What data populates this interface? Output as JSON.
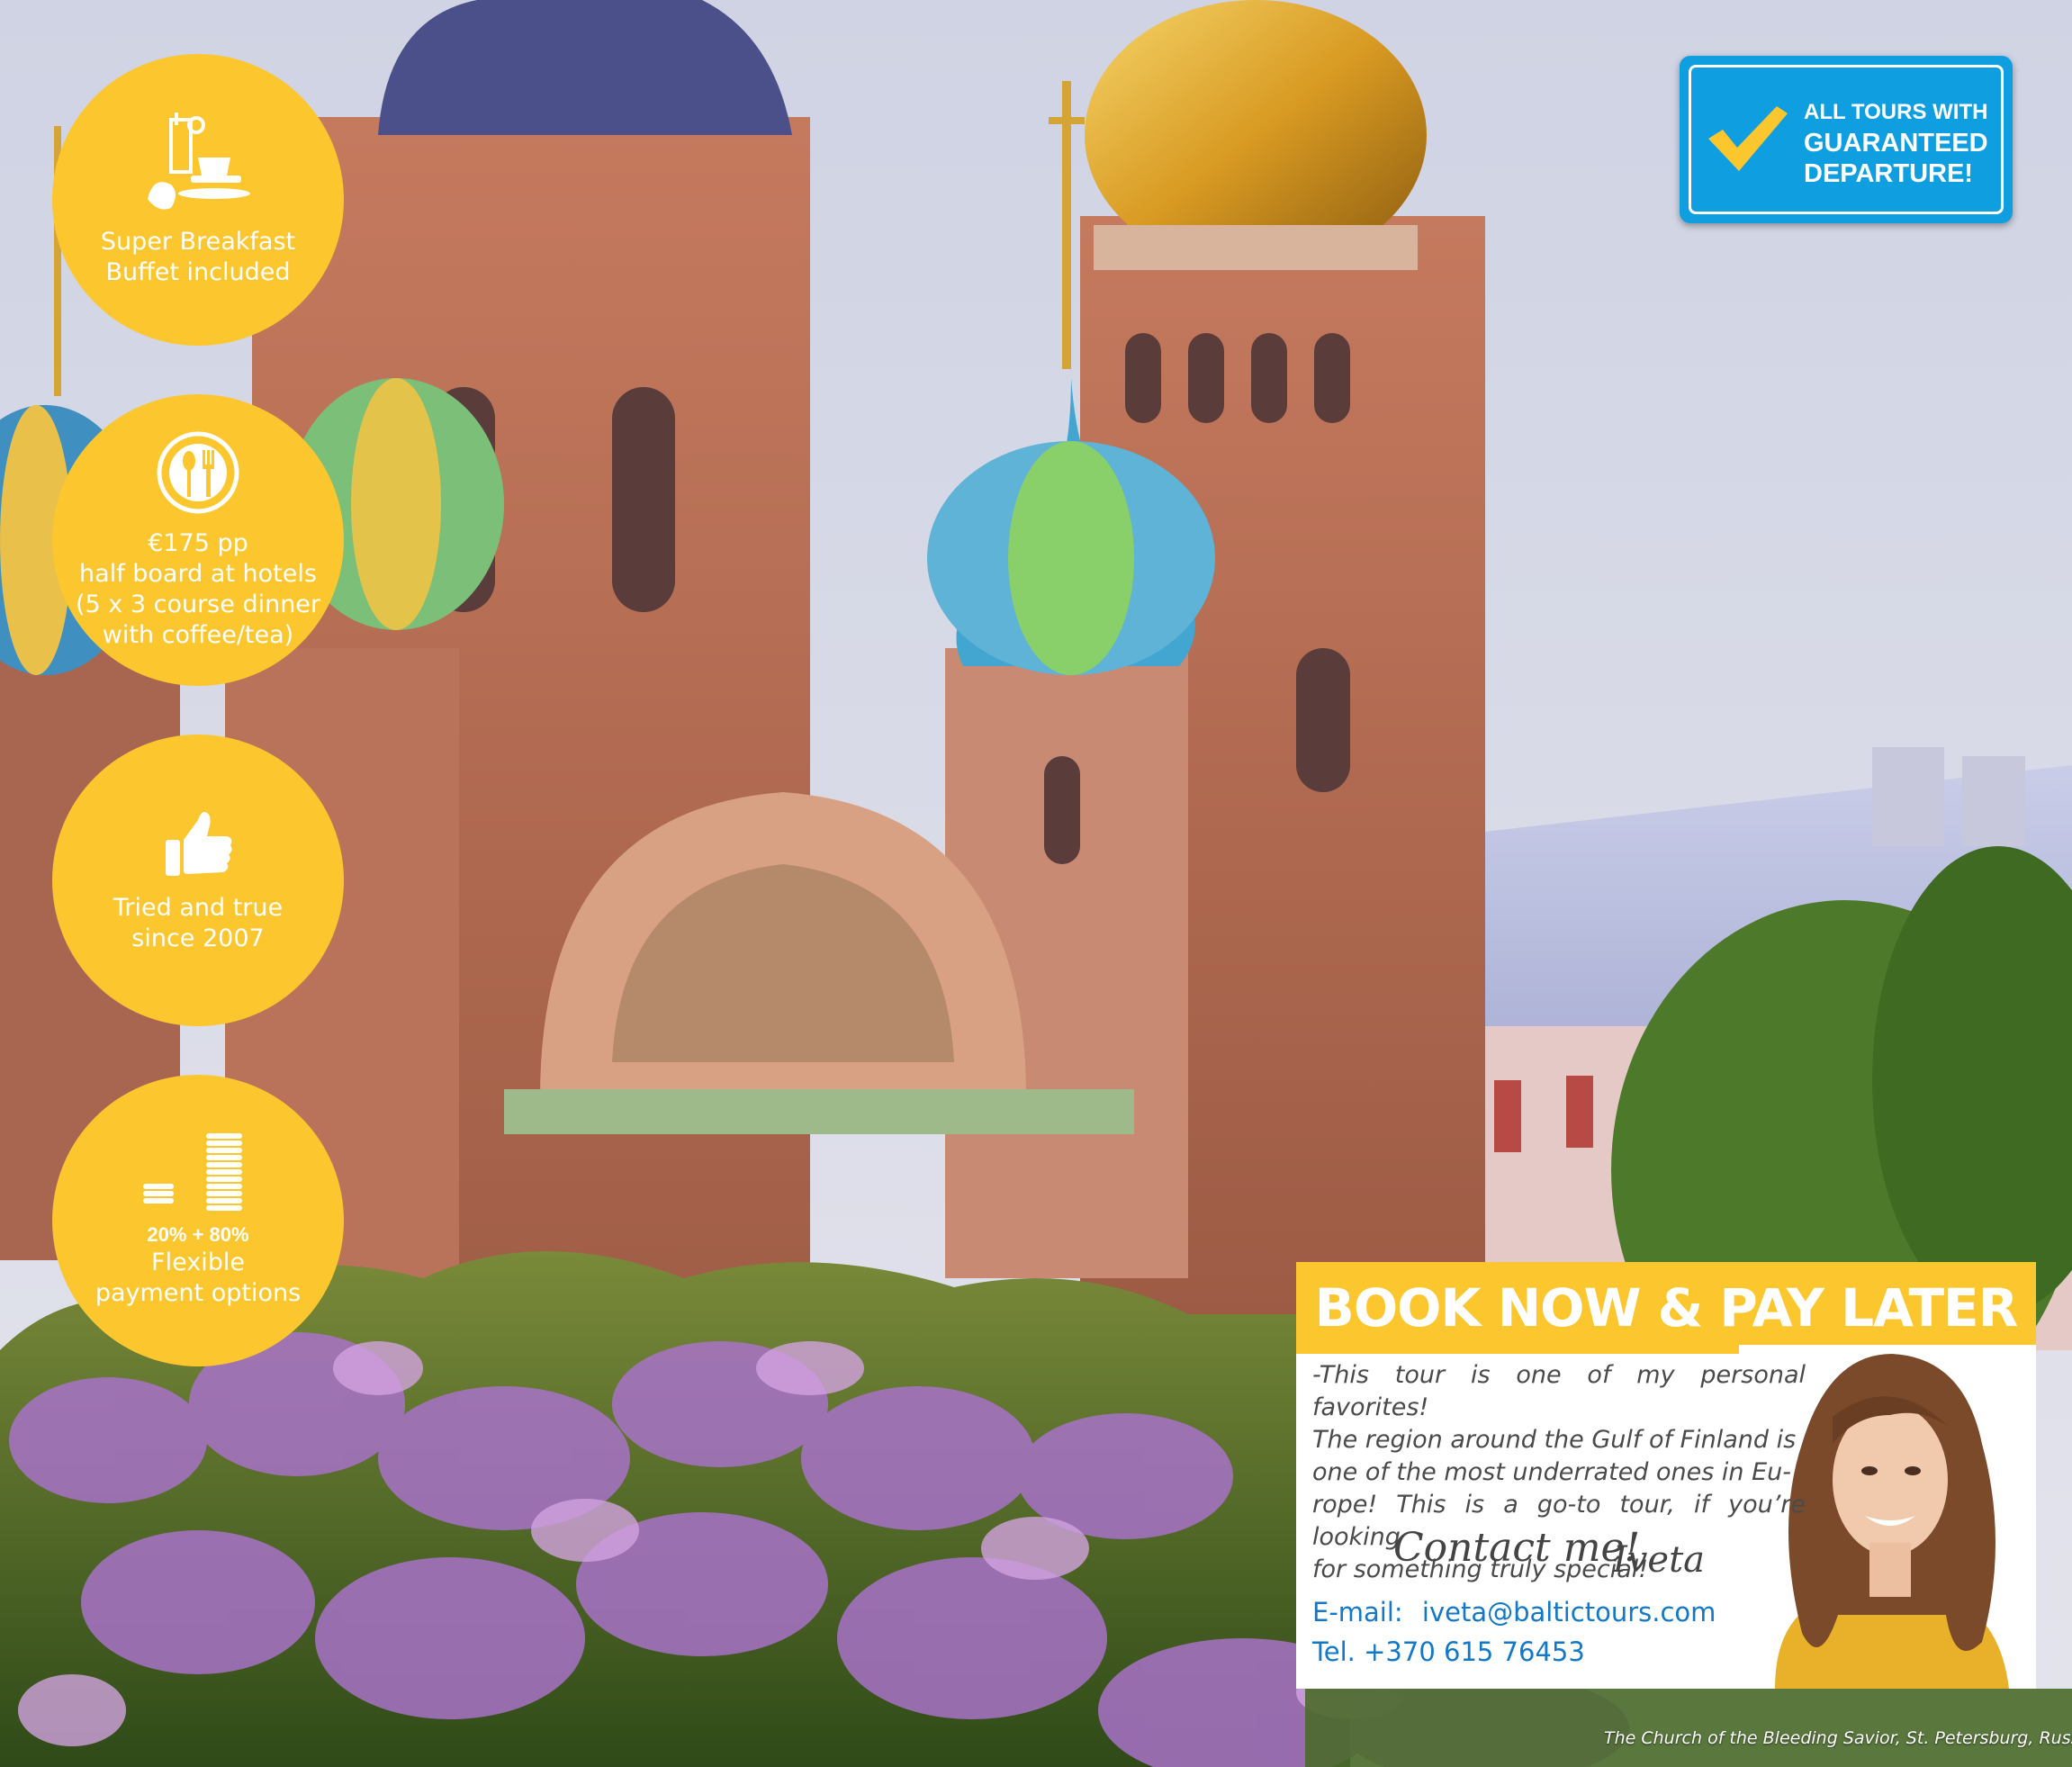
{
  "features": [
    {
      "icon": "breakfast-icon",
      "lines": [
        "Super Breakfast",
        "Buffet included"
      ]
    },
    {
      "icon": "dining-plate-icon",
      "lines": [
        "€175 pp",
        "half board at hotels",
        "(5 x 3 course dinner",
        "with coffee/tea)"
      ]
    },
    {
      "icon": "thumbs-up-icon",
      "lines": [
        "Tried and true",
        "since 2007"
      ]
    },
    {
      "icon": "coins-icon",
      "split": "20% + 80%",
      "lines": [
        "Flexible",
        "payment options"
      ]
    }
  ],
  "badge": {
    "icon": "checkmark-icon",
    "line1": "ALL TOURS WITH",
    "line2": "GUARANTEED",
    "line3": "DEPARTURE!"
  },
  "book": {
    "title": "BOOK NOW & PAY LATER",
    "quote": [
      "-This tour is one of my personal favorites!",
      "The region around the Gulf of Finland is",
      "one of the most underrated ones in Eu-",
      "rope! This is a go-to tour, if you’re looking",
      "for something truly special!"
    ],
    "contact_me": "Contact me!",
    "signature": "Iveta",
    "email_label": "E-mail:",
    "email": "iveta@baltictours.com",
    "tel": "Tel. +370 615 76453"
  },
  "caption": "The Church of the Bleeding Savior, St. Petersburg, Russ",
  "colors": {
    "yellow": "#fcc72e",
    "blue": "#0f9ee0",
    "link": "#1378c8"
  }
}
